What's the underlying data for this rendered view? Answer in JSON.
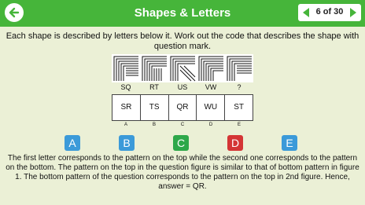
{
  "header": {
    "title": "Shapes & Letters",
    "page_counter": "6 of 30",
    "color": "#46b53a"
  },
  "question": {
    "text": "Each shape is described by letters below it. Work out the code that describes the shape with question mark.",
    "figure_codes": [
      "SQ",
      "RT",
      "US",
      "VW",
      "?"
    ]
  },
  "answer_options": {
    "codes": [
      "SR",
      "TS",
      "QR",
      "WU",
      "ST"
    ],
    "letters": [
      "A",
      "B",
      "C",
      "D",
      "E"
    ]
  },
  "buttons": [
    {
      "label": "A",
      "color": "#3b9ad9"
    },
    {
      "label": "B",
      "color": "#3b9ad9"
    },
    {
      "label": "C",
      "color": "#2ea84a"
    },
    {
      "label": "D",
      "color": "#d43535"
    },
    {
      "label": "E",
      "color": "#3b9ad9"
    }
  ],
  "explanation": "The first letter corresponds to the pattern on the top while the second one corresponds to the pattern on the bottom. The pattern on the top in the question figure is similar to that of bottom pattern in figure 1. The bottom pattern of the question corresponds to the pattern on the top in 2nd figure. Hence, answer = QR."
}
